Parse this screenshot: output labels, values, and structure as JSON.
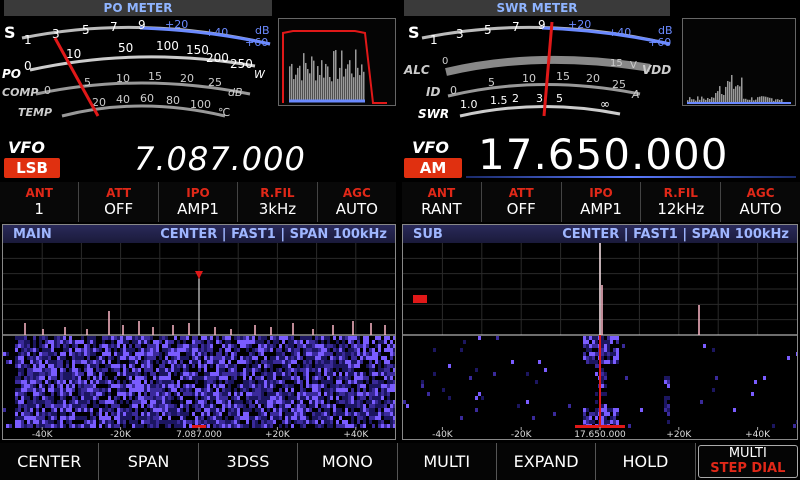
{
  "po_meter": {
    "title": "PO METER",
    "s_label": "S",
    "s_scale": [
      "1",
      "3",
      "5",
      "7",
      "9"
    ],
    "db_scale": [
      "+20",
      "+40",
      "+60"
    ],
    "db_unit": "dB",
    "po_label": "PO",
    "po_scale": [
      "0",
      "10",
      "50",
      "100",
      "150",
      "200",
      "250"
    ],
    "po_unit": "W",
    "comp_label": "COMP",
    "comp_scale": [
      "0",
      "5",
      "10",
      "15",
      "20",
      "25"
    ],
    "comp_unit": "dB",
    "temp_label": "TEMP",
    "temp_scale": [
      "20",
      "40",
      "60",
      "80",
      "100"
    ],
    "temp_unit": "℃"
  },
  "swr_meter": {
    "title": "SWR METER",
    "s_label": "S",
    "s_scale": [
      "1",
      "3",
      "5",
      "7",
      "9"
    ],
    "db_scale": [
      "+20",
      "+40",
      "+60"
    ],
    "db_unit": "dB",
    "alc_label": "ALC",
    "vdd_label": "VDD",
    "vdd_scale": [
      "0",
      "15"
    ],
    "vdd_unit": "V",
    "id_label": "ID",
    "id_scale": [
      "0",
      "5",
      "10",
      "15",
      "20",
      "25"
    ],
    "id_unit": "A",
    "swr_label": "SWR",
    "swr_scale": [
      "1.0",
      "1.5",
      "2",
      "3",
      "5",
      "∞"
    ]
  },
  "vfo_main": {
    "label": "VFO",
    "mode": "LSB",
    "frequency": "7.087.000"
  },
  "vfo_sub": {
    "label": "VFO",
    "mode": "AM",
    "frequency": "17.650.000"
  },
  "params_main": [
    {
      "label": "ANT",
      "value": "1"
    },
    {
      "label": "ATT",
      "value": "OFF"
    },
    {
      "label": "IPO",
      "value": "AMP1"
    },
    {
      "label": "R.FIL",
      "value": "3kHz"
    },
    {
      "label": "AGC",
      "value": "AUTO"
    }
  ],
  "params_sub": [
    {
      "label": "ANT",
      "value": "RANT"
    },
    {
      "label": "ATT",
      "value": "OFF"
    },
    {
      "label": "IPO",
      "value": "AMP1"
    },
    {
      "label": "R.FIL",
      "value": "12kHz"
    },
    {
      "label": "AGC",
      "value": "AUTO"
    }
  ],
  "scope_main": {
    "name": "MAIN",
    "settings": "CENTER | FAST1 | SPAN   100kHz",
    "axis": [
      "-40K",
      "-20K",
      "7.087.000",
      "+20K",
      "+40K"
    ]
  },
  "scope_sub": {
    "name": "SUB",
    "settings": "CENTER | FAST1 | SPAN   100kHz",
    "axis": [
      "-40K",
      "-20K",
      "17.650.000",
      "+20K",
      "+40K"
    ]
  },
  "softkeys": [
    {
      "label": "CENTER"
    },
    {
      "label": "SPAN"
    },
    {
      "label": "3DSS"
    },
    {
      "label": "MONO"
    },
    {
      "label": "MULTI"
    },
    {
      "label": "EXPAND"
    },
    {
      "label": "HOLD"
    }
  ],
  "softkey_multi": {
    "top": "MULTI",
    "bottom": "STEP DIAL"
  },
  "colors": {
    "accent_red": "#e02818",
    "scale_blue": "#6b8aff",
    "needle": "#e01818"
  }
}
